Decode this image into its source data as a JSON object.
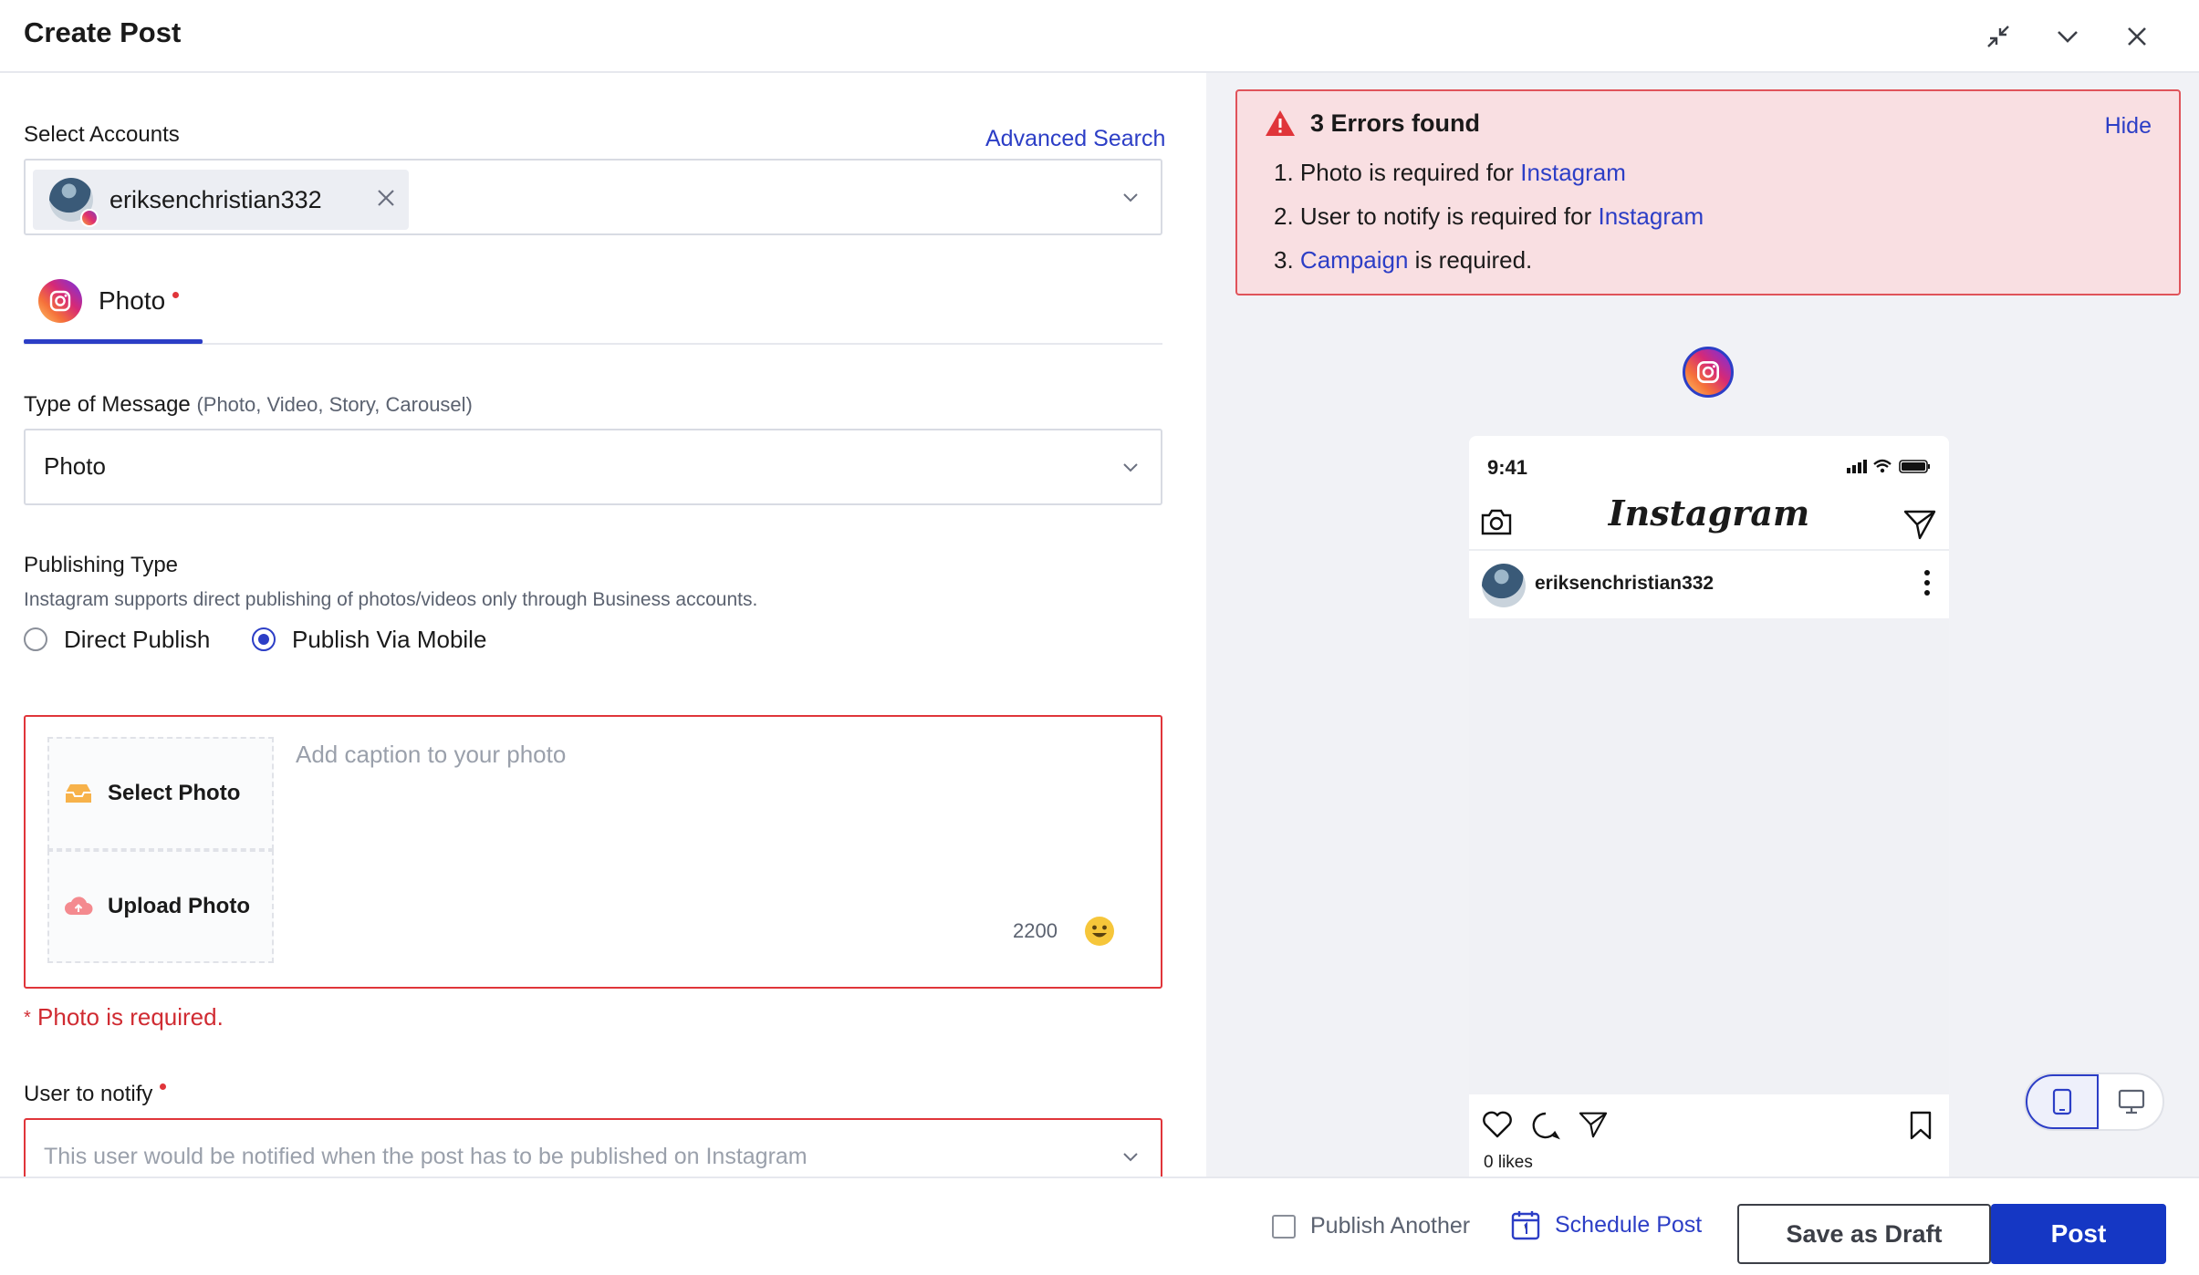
{
  "header": {
    "title": "Create Post",
    "icons": [
      "collapse-icon",
      "chevron-down-icon",
      "close-icon"
    ]
  },
  "accounts": {
    "label": "Select Accounts",
    "advanced_search": "Advanced Search",
    "selected": "eriksenchristian332"
  },
  "tab": {
    "label": "Photo"
  },
  "message_type": {
    "label": "Type of Message",
    "hint": "(Photo, Video, Story, Carousel)",
    "value": "Photo"
  },
  "publishing": {
    "label": "Publishing Type",
    "hint": "Instagram supports direct publishing of photos/videos only through Business accounts.",
    "options": [
      "Direct Publish",
      "Publish Via Mobile"
    ],
    "selected": "Publish Via Mobile"
  },
  "composer": {
    "select_photo": "Select Photo",
    "upload_photo": "Upload Photo",
    "caption_placeholder": "Add caption to your photo",
    "char_count": "2200",
    "error": "Photo is required."
  },
  "notify": {
    "label": "User to notify",
    "placeholder": "This user would be notified when the post has to be published on Instagram"
  },
  "errors": {
    "title": "3 Errors found",
    "hide": "Hide",
    "items": [
      {
        "num": "1.",
        "pre": "Photo is required for ",
        "link": "Instagram",
        "post": ""
      },
      {
        "num": "2.",
        "pre": "User to notify is required for ",
        "link": "Instagram",
        "post": ""
      },
      {
        "num": "3.",
        "pre": "",
        "link": "Campaign",
        "post": " is required."
      }
    ]
  },
  "preview": {
    "time": "9:41",
    "app_name": "Instagram",
    "username": "eriksenchristian332",
    "likes": "0 likes"
  },
  "footer": {
    "publish_another": "Publish Another",
    "schedule": "Schedule Post",
    "draft": "Save as Draft",
    "post": "Post"
  },
  "colors": {
    "accent": "#2c3ec6",
    "primary_button": "#1537c4",
    "error": "#e0353a",
    "error_bg": "#f9dfe2"
  }
}
